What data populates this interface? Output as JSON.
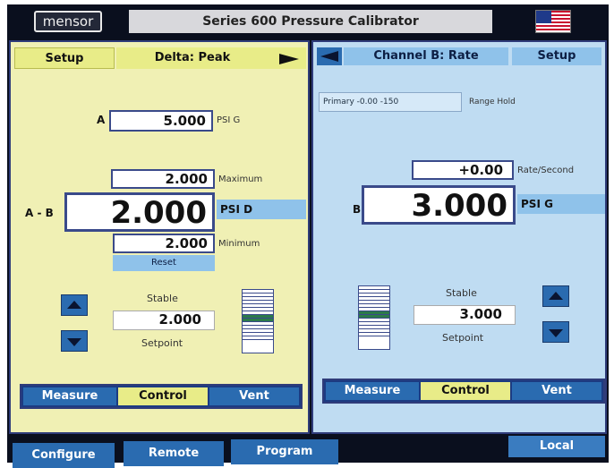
{
  "header": {
    "logo": "mensor",
    "title": "Series 600 Pressure Calibrator",
    "flag_icon": "us-flag-icon"
  },
  "channel_a": {
    "setup_label": "Setup",
    "title": "Delta: Peak",
    "reading_label_top": "A",
    "reading_top": "5.000",
    "unit_top": "PSI G",
    "maximum_value": "2.000",
    "maximum_label": "Maximum",
    "delta_label": "A - B",
    "main_value": "2.000",
    "main_unit": "PSI D",
    "minimum_value": "2.000",
    "minimum_label": "Minimum",
    "reset_label": "Reset",
    "stable_label": "Stable",
    "setpoint_value": "2.000",
    "setpoint_label": "Setpoint",
    "modes": [
      "Measure",
      "Control",
      "Vent"
    ],
    "active_mode": "Control"
  },
  "channel_b": {
    "title": "Channel B: Rate",
    "setup_label": "Setup",
    "range_value": "Primary -0.00 -150",
    "range_hold_label": "Range Hold",
    "rate_value": "+0.00",
    "rate_label": "Rate/Second",
    "channel_label": "B",
    "main_value": "3.000",
    "main_unit": "PSI G",
    "stable_label": "Stable",
    "setpoint_value": "3.000",
    "setpoint_label": "Setpoint",
    "modes": [
      "Measure",
      "Control",
      "Vent"
    ],
    "active_mode": "Control"
  },
  "footer": {
    "configure": "Configure",
    "remote": "Remote",
    "program": "Program",
    "local": "Local"
  },
  "colors": {
    "panel_a_bg": "#f0f0b4",
    "panel_b_bg": "#bfdcf2",
    "button_blue": "#2a6bb0",
    "button_yellow": "#e8ec88",
    "frame": "#0a0f1e"
  }
}
